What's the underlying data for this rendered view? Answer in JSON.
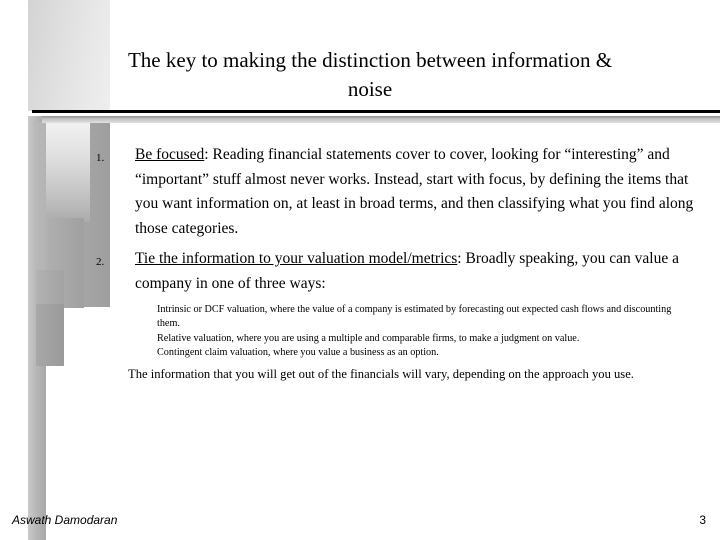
{
  "slide": {
    "title": "The key to making the distinction between information &\nnoise",
    "numbered_items": [
      {
        "marker": "1.",
        "lead": "Be focused",
        "body": ": Reading financial statements cover to cover, looking for “interesting” and “important” stuff almost never works. Instead, start with focus, by defining the items that you want information on, at least in broad terms, and then classifying what you find along those categories."
      },
      {
        "marker": "2.",
        "lead": "Tie the information to your valuation model/metrics",
        "body": ": Broadly speaking, you can value a company in one of three ways:"
      }
    ],
    "sub_items": [
      "Intrinsic or DCF valuation, where the value of a company is estimated by forecasting out expected cash flows and discounting them.",
      "Relative valuation, where you are using a multiple and comparable firms, to make a judgment on value.",
      "Contingent claim valuation, where you value a business as an option."
    ],
    "closing": "The information that you will get out of the financials will vary, depending on the approach you use."
  },
  "footer": {
    "author": "Aswath Damodaran",
    "page_number": "3"
  },
  "colors": {
    "rule": "#000000",
    "text": "#000000",
    "deco_light": "#e8e8e8",
    "deco_mid": "#a6a6a6",
    "background": "#ffffff"
  }
}
